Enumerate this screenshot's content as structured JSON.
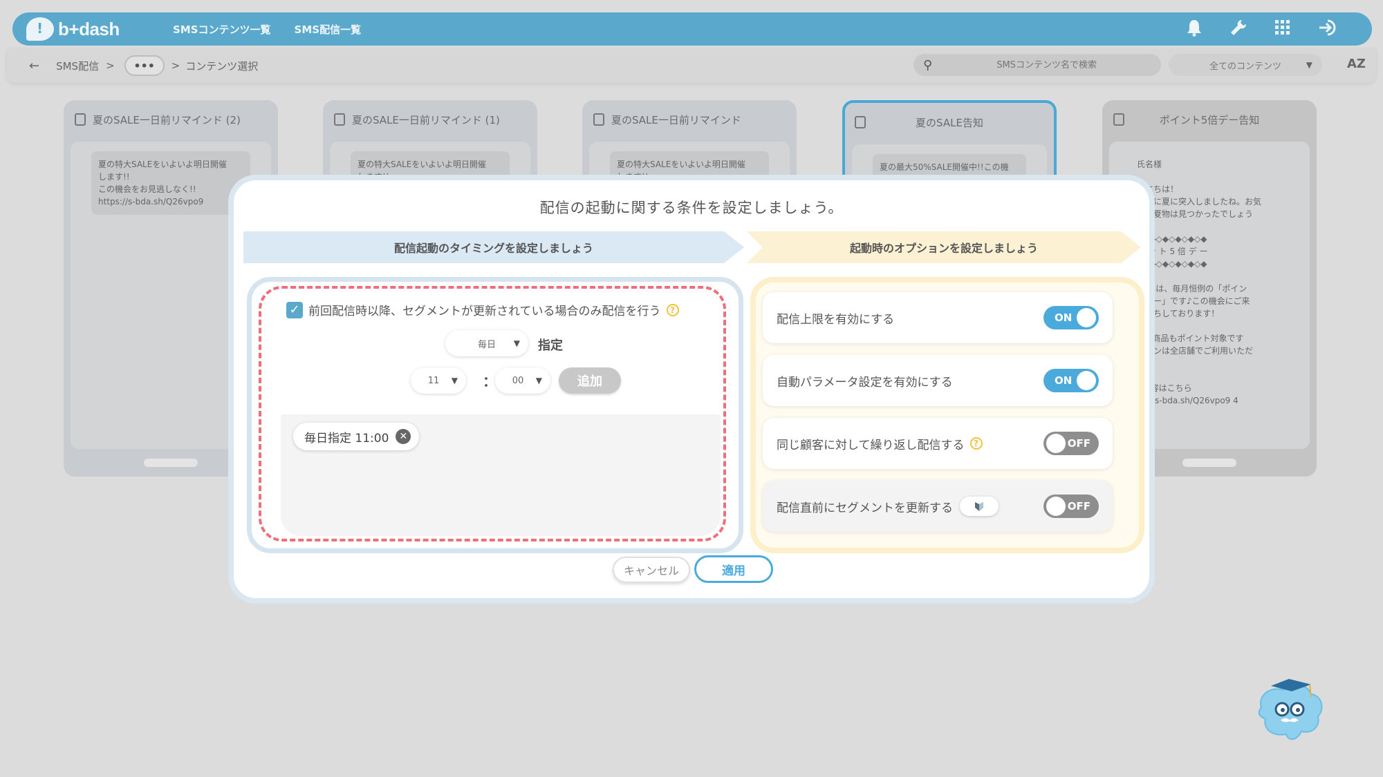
{
  "header": {
    "logo_text": "b+dash",
    "nav": [
      "SMSコンテンツ一覧",
      "SMS配信一覧"
    ],
    "icons": [
      "bell-icon",
      "wrench-icon",
      "grid-icon",
      "logout-icon"
    ]
  },
  "subbar": {
    "back": "←",
    "crumb_root": "SMS配信",
    "sep1": ">",
    "dots": "•••",
    "sep2": ">",
    "crumb_current": "コンテンツ選択",
    "search_placeholder": "SMSコンテンツ名で検索",
    "filter_value": "全てのコンテンツ",
    "sort_label": "AZ"
  },
  "cards": [
    {
      "title": "夏のSALE一日前リマインド (2)",
      "text": "夏の特大SALEをいよいよ明日開催\nします!!\nこの機会をお見逃しなく!!\nhttps://s-bda.sh/Q26vpo9"
    },
    {
      "title": "夏のSALE一日前リマインド (1)",
      "text": "夏の特大SALEをいよいよ明日開催\nします!!"
    },
    {
      "title": "夏のSALE一日前リマインド",
      "text": "夏の特大SALEをいよいよ明日開催\nします!!"
    },
    {
      "title": "夏のSALE告知",
      "text": "夏の最大50%SALE開催中!!この機\n会にぜひお買い求め下さい!!"
    },
    {
      "title": "ポイント5倍デー告知",
      "text": "氏名様\n\nんにちは！\n格的に夏に突入しましたね。お気\nりの夏物は見つかったでしょう\n\n◆◇◆◇◆◇◆◇◆◇◆\nイ ン ト 5 倍 デ ー\n◆◇◆◇◆◇◆◇◆◇◆\n\n10日は、毎月恒例の「ポイン\n倍デー」です♪この機会にご来\nお待ちしております！\n\nALE商品もポイント対象です\nーポンは全店舗でご利用いただ\nす\n\nE内容はこちら\nps://s-bda.sh/Q26vpo9 4"
    }
  ],
  "modal": {
    "title": "配信の起動に関する条件を設定しましょう。",
    "step1": "配信起動のタイミングを設定しましょう",
    "step2": "起動時のオプションを設定しましょう",
    "checkbox_label": "前回配信時以降、セグメントが更新されている場合のみ配信を行う",
    "checkbox_checked": true,
    "frequency_value": "毎日",
    "frequency_suffix": "指定",
    "hour_value": "11",
    "colon": "：",
    "minute_value": "00",
    "add_label": "追加",
    "schedule_items": [
      "毎日指定 11:00"
    ],
    "options": [
      {
        "label": "配信上限を有効にする",
        "state": "ON"
      },
      {
        "label": "自動パラメータ設定を有効にする",
        "state": "ON"
      },
      {
        "label": "同じ顧客に対して繰り返し配信する",
        "state": "OFF"
      },
      {
        "label": "配信直前にセグメントを更新する",
        "state": "OFF"
      }
    ],
    "cancel_label": "キャンセル",
    "apply_label": "適用"
  },
  "colors": {
    "accent": "#4aaadb",
    "header": "#5aa8cb",
    "dashed": "#ee6e7a",
    "step1": "#dbe9f4",
    "step2": "#fdf1d4"
  }
}
